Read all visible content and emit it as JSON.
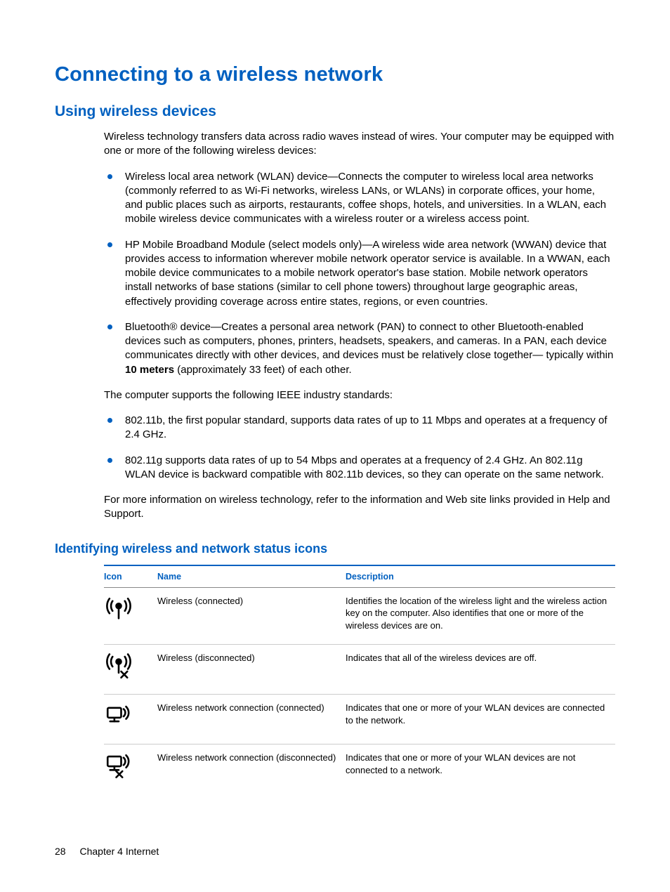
{
  "h1": "Connecting to a wireless network",
  "h2": "Using wireless devices",
  "intro": "Wireless technology transfers data across radio waves instead of wires. Your computer may be equipped with one or more of the following wireless devices:",
  "devices": [
    "Wireless local area network (WLAN) device—Connects the computer to wireless local area networks (commonly referred to as Wi-Fi networks, wireless LANs, or WLANs) in corporate offices, your home, and public places such as airports, restaurants, coffee shops, hotels, and universities. In a WLAN, each mobile wireless device communicates with a wireless router or a wireless access point.",
    "HP Mobile Broadband Module (select models only)—A wireless wide area network (WWAN) device that provides access to information wherever mobile network operator service is available. In a WWAN, each mobile device communicates to a mobile network operator's base station. Mobile network operators install networks of base stations (similar to cell phone towers) throughout large geographic areas, effectively providing coverage across entire states, regions, or even countries.",
    "Bluetooth® device—Creates a personal area network (PAN) to connect to other Bluetooth-enabled devices such as computers, phones, printers, headsets, speakers, and cameras. In a PAN, each device communicates directly with other devices, and devices must be relatively close together—"
  ],
  "bluetooth_tail_pre": "typically within ",
  "bluetooth_bold": "10 meters",
  "bluetooth_tail_post": " (approximately 33 feet) of each other.",
  "standards_intro": "The computer supports the following IEEE industry standards:",
  "standards": [
    "802.11b, the first popular standard, supports data rates of up to 11 Mbps and operates at a frequency of 2.4 GHz.",
    "802.11g supports data rates of up to 54 Mbps and operates at a frequency of 2.4 GHz. An 802.11g WLAN device is backward compatible with 802.11b devices, so they can operate on the same network."
  ],
  "outro": "For more information on wireless technology, refer to the information and Web site links provided in Help and Support.",
  "h3": "Identifying wireless and network status icons",
  "table": {
    "head": {
      "icon": "Icon",
      "name": "Name",
      "desc": "Description"
    },
    "rows": [
      {
        "name": "Wireless (connected)",
        "desc": "Identifies the location of the wireless light and the wireless action key on the computer. Also identifies that one or more of the wireless devices are on.",
        "icon": "wireless-on"
      },
      {
        "name": "Wireless (disconnected)",
        "desc": "Indicates that all of the wireless devices are off.",
        "icon": "wireless-off"
      },
      {
        "name": "Wireless network connection (connected)",
        "desc": "Indicates that one or more of your WLAN devices are connected to the network.",
        "icon": "net-on"
      },
      {
        "name": "Wireless network connection (disconnected)",
        "desc": "Indicates that one or more of your WLAN devices are not connected to a network.",
        "icon": "net-off"
      }
    ]
  },
  "footer": {
    "page": "28",
    "chapter": "Chapter 4   Internet"
  }
}
